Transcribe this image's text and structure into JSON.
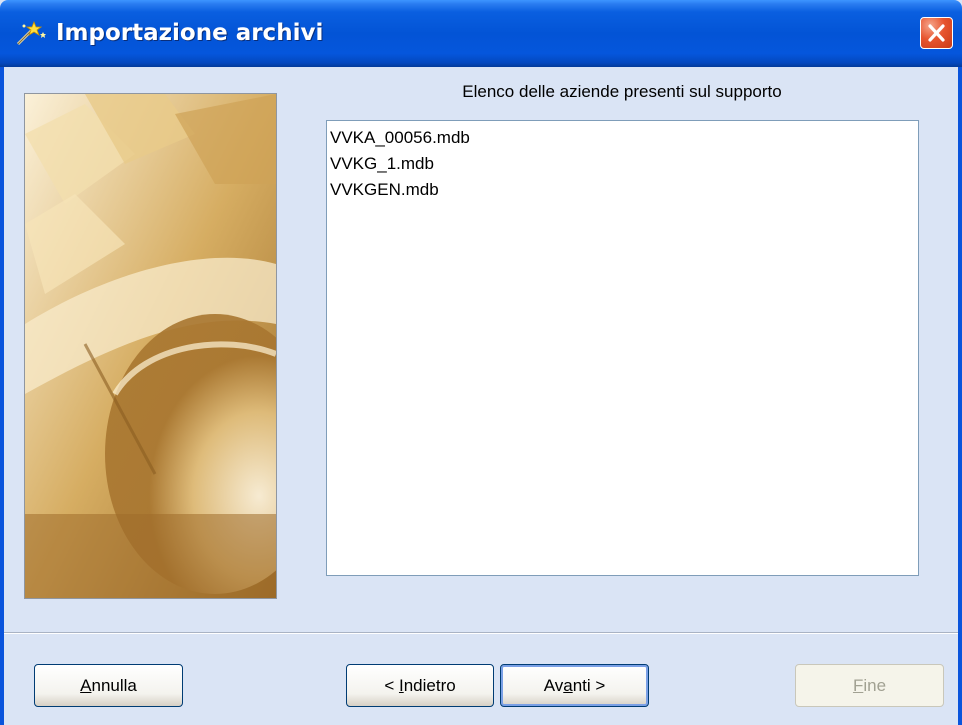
{
  "window": {
    "title": "Importazione archivi",
    "title_icon": "wizard-wand-icon",
    "close_icon": "close-icon"
  },
  "main": {
    "heading": "Elenco delle aziende presenti sul supporto",
    "files": [
      "VVKA_00056.mdb",
      "VVKG_1.mdb",
      "VVKGEN.mdb"
    ]
  },
  "buttons": {
    "cancel": {
      "label_pre": "",
      "label_key": "A",
      "label_post": "nnulla"
    },
    "back": {
      "label_pre": "< ",
      "label_key": "I",
      "label_post": "ndietro"
    },
    "next": {
      "label_pre": "Av",
      "label_key": "a",
      "label_post": "nti >"
    },
    "finish": {
      "label_pre": "",
      "label_key": "F",
      "label_post": "ine"
    }
  },
  "colors": {
    "titlebar": "#0354d6",
    "dialog_bg": "#dae4f5",
    "close_button": "#e7552f"
  }
}
